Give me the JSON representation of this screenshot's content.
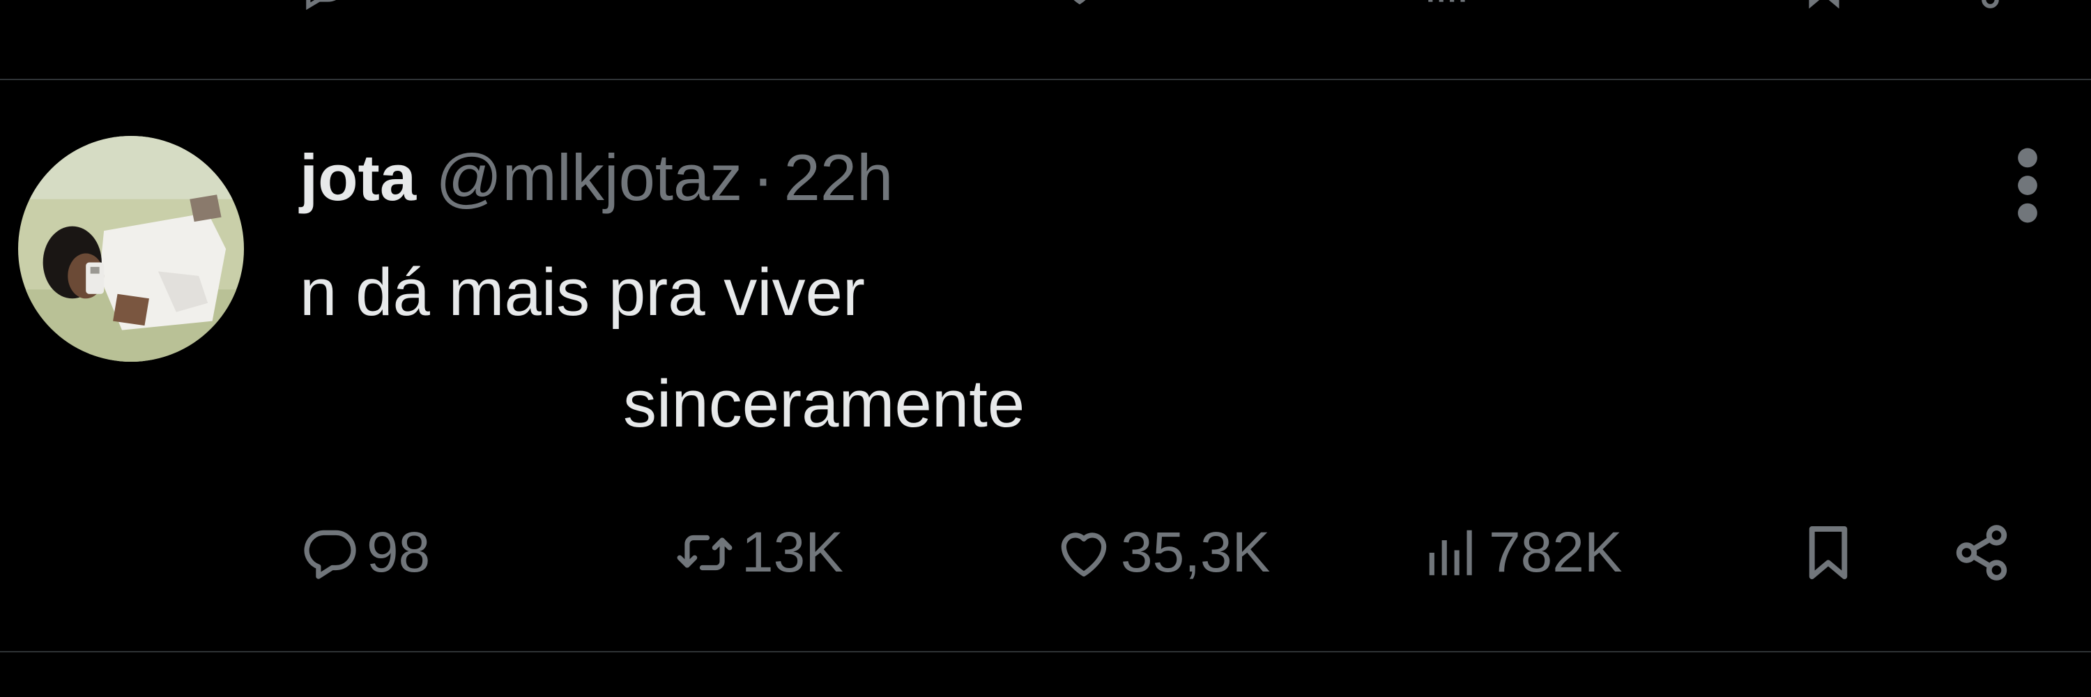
{
  "tweet": {
    "author": {
      "display_name": "jota",
      "handle": "@mlkjotaz",
      "separator": "·",
      "time": "22h"
    },
    "text_lines": [
      "n dá mais pra viver",
      "sinceramente"
    ],
    "stats": {
      "replies": "98",
      "retweets": "13K",
      "likes": "35,3K",
      "views": "782K"
    }
  },
  "icons": {
    "reply": "reply-icon",
    "retweet": "retweet-icon",
    "like": "heart-icon",
    "views": "views-icon",
    "bookmark": "bookmark-icon",
    "share": "share-icon",
    "more": "more-icon"
  },
  "colors": {
    "background": "#000000",
    "primary_text": "#e7e9ea",
    "secondary_text": "#71767b",
    "divider": "#2f3336"
  }
}
